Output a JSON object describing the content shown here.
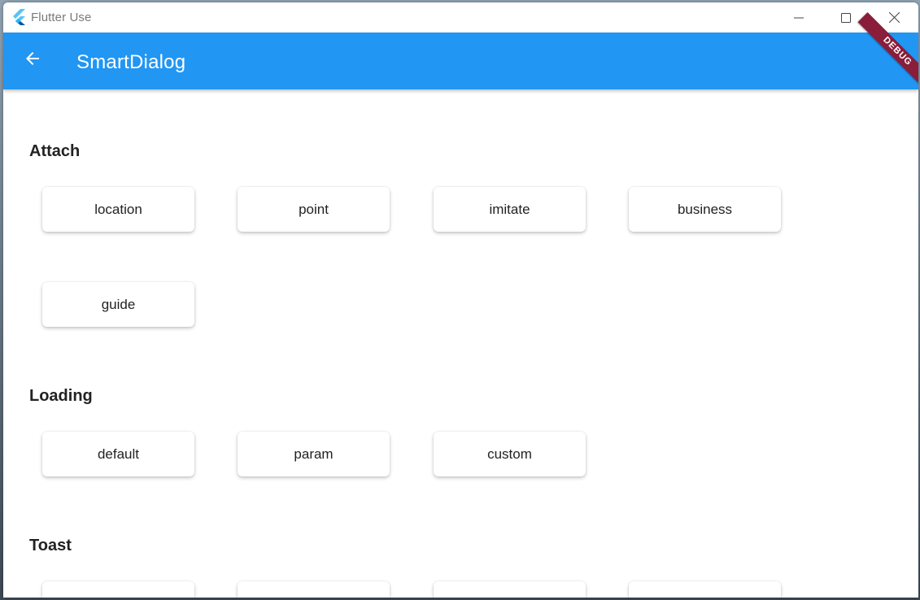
{
  "window": {
    "title": "Flutter Use"
  },
  "appbar": {
    "title": "SmartDialog",
    "debug_banner": "DEBUG",
    "color": "#2196f3"
  },
  "sections": {
    "attach": {
      "title": "Attach",
      "buttons": [
        "location",
        "point",
        "imitate",
        "business",
        "guide"
      ]
    },
    "loading": {
      "title": "Loading",
      "buttons": [
        "default",
        "param",
        "custom"
      ]
    },
    "toast": {
      "title": "Toast",
      "buttons": [
        "",
        "",
        "",
        ""
      ]
    }
  },
  "icons": {
    "logo": "flutter-logo-icon",
    "back": "arrow-back-icon",
    "minimize": "minimize-icon",
    "maximize": "maximize-icon",
    "close": "close-icon"
  }
}
